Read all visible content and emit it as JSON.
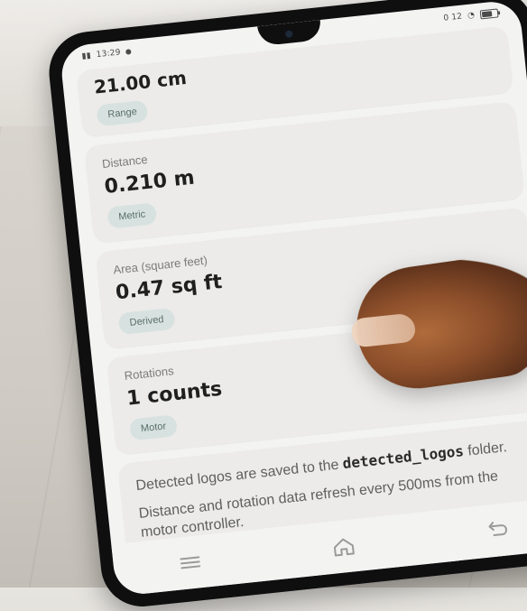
{
  "status_bar": {
    "left_text": "13:29",
    "right_text": "0 12"
  },
  "cards": [
    {
      "value_text": "21.00 cm",
      "chip": "Range"
    },
    {
      "label": "Distance",
      "value_text": "0.210 m",
      "chip": "Metric"
    },
    {
      "label": "Area (square feet)",
      "value_text": "0.47 sq ft",
      "chip": "Derived"
    },
    {
      "label": "Rotations",
      "value_text": "1 counts",
      "chip": "Motor"
    }
  ],
  "info": {
    "line1_prefix": "Detected logos are saved to the",
    "line1_code": "detected_logos",
    "line1_suffix": "folder.",
    "line2": "Distance and rotation data refresh every 500ms from the motor controller."
  },
  "nav": {
    "icons": [
      "menu-icon",
      "home-icon",
      "back-icon"
    ]
  },
  "colors": {
    "chip_bg": "#d7e2e0",
    "card_bg": "#ecebe9",
    "screen_bg": "#f3f3f2",
    "text_primary": "#1f1f1f",
    "text_secondary": "#7b7b7b"
  }
}
